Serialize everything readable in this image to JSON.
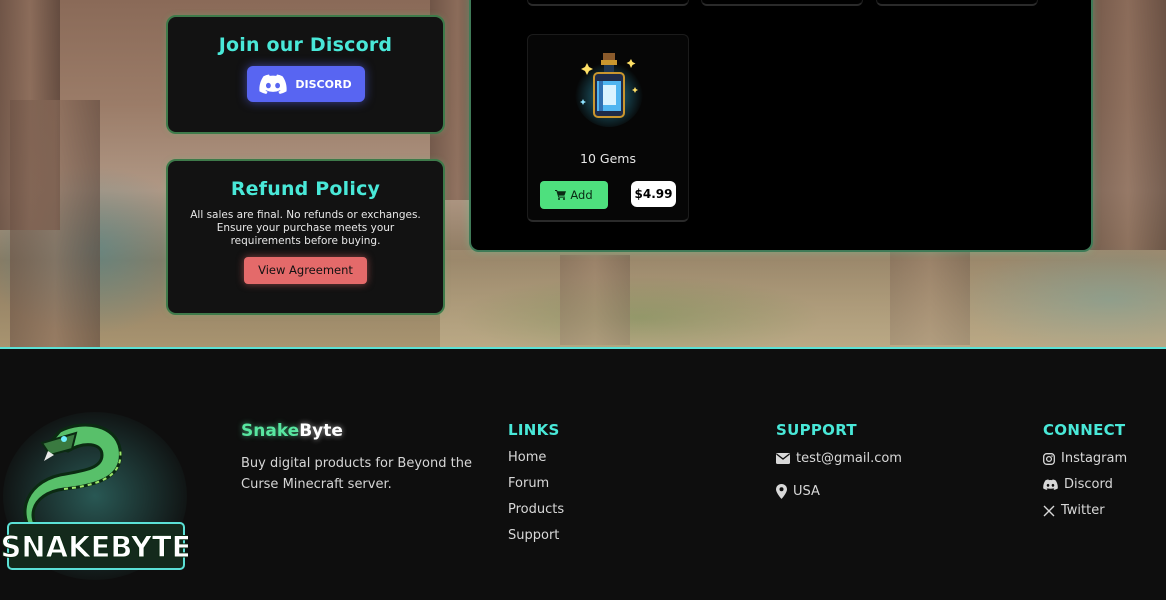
{
  "discord_card": {
    "title": "Join our Discord",
    "button_label": "DISCORD",
    "button_color": "#5865f2"
  },
  "refund_card": {
    "title": "Refund Policy",
    "text": "All sales are final. No refunds or exchanges. Ensure your purchase meets your requirements before buying.",
    "button_label": "View Agreement",
    "button_color": "#e46a6a"
  },
  "products": [
    {
      "name": "10 Gems",
      "add_label": "Add",
      "price": "$4.99",
      "icon": "potion-bottle-icon"
    }
  ],
  "footer": {
    "brand_part1": "Snake",
    "brand_part2": "Byte",
    "description": "Buy digital products for Beyond the Curse Minecraft server.",
    "logo_text": "SNAKEBYTE",
    "links": {
      "title": "LINKS",
      "items": [
        "Home",
        "Forum",
        "Products",
        "Support"
      ]
    },
    "support": {
      "title": "SUPPORT",
      "email": "test@gmail.com",
      "location": "USA"
    },
    "connect": {
      "title": "CONNECT",
      "items": [
        "Instagram",
        "Discord",
        "Twitter"
      ]
    }
  },
  "colors": {
    "accent": "#49e8d8",
    "add_button": "#4ee07e",
    "brand_green": "#58e6a0"
  }
}
